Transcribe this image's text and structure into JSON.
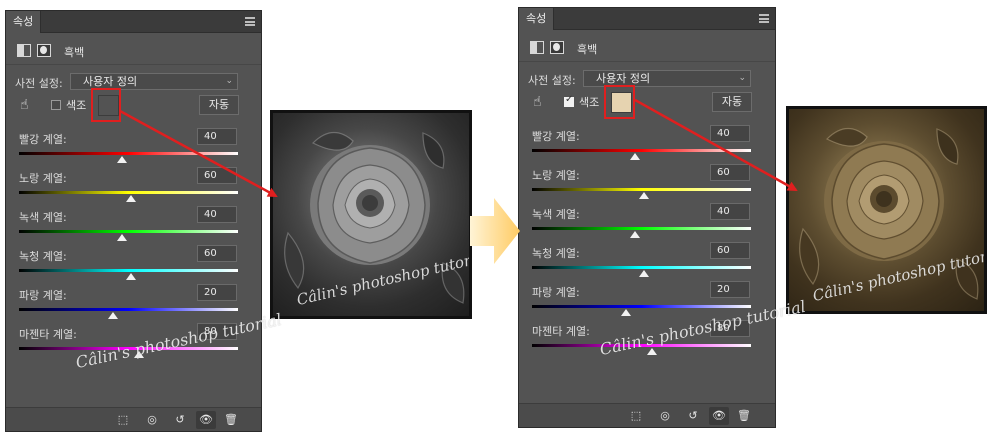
{
  "panels": [
    {
      "tab": "속성",
      "layer_name": "흑백",
      "preset_label": "사전 설정:",
      "preset_value": "사용자 정의",
      "tint_label": "색조",
      "tint_checked": false,
      "tint_color": "#535353",
      "auto_label": "자동",
      "sliders": [
        {
          "label": "빨강 계열:",
          "value": "40",
          "fraction": 0.47
        },
        {
          "label": "노랑 계열:",
          "value": "60",
          "fraction": 0.51
        },
        {
          "label": "녹색 계열:",
          "value": "40",
          "fraction": 0.47
        },
        {
          "label": "녹청 계열:",
          "value": "60",
          "fraction": 0.51
        },
        {
          "label": "파랑 계열:",
          "value": "20",
          "fraction": 0.43
        },
        {
          "label": "마젠타 계열:",
          "value": "80",
          "fraction": 0.55
        }
      ]
    },
    {
      "tab": "속성",
      "layer_name": "흑백",
      "preset_label": "사전 설정:",
      "preset_value": "사용자 정의",
      "tint_label": "색조",
      "tint_checked": true,
      "tint_color": "#e6d3b0",
      "auto_label": "자동",
      "sliders": [
        {
          "label": "빨강 계열:",
          "value": "40",
          "fraction": 0.47
        },
        {
          "label": "노랑 계열:",
          "value": "60",
          "fraction": 0.51
        },
        {
          "label": "녹색 계열:",
          "value": "40",
          "fraction": 0.47
        },
        {
          "label": "녹청 계열:",
          "value": "60",
          "fraction": 0.51
        },
        {
          "label": "파랑 계열:",
          "value": "20",
          "fraction": 0.43
        },
        {
          "label": "마젠타 계열:",
          "value": "80",
          "fraction": 0.55
        }
      ]
    }
  ],
  "slider_gradients": [
    [
      "#000000",
      "#ff0000",
      "#ffffff"
    ],
    [
      "#000000",
      "#ffff00",
      "#ffffff"
    ],
    [
      "#000000",
      "#00ff00",
      "#ffffff"
    ],
    [
      "#000000",
      "#00ffff",
      "#ffffff"
    ],
    [
      "#000000",
      "#0000ff",
      "#ffffff"
    ],
    [
      "#000000",
      "#ff00ff",
      "#ffffff"
    ]
  ],
  "bottom_icons": [
    "clip-to-layer-icon",
    "view-previous-state-icon",
    "reset-icon",
    "visibility-eye-icon",
    "delete-trash-icon"
  ],
  "watermark": "Câlin's photoshop tutorial",
  "accent_red": "#e01f1f",
  "arrow_color": "#ffd27a"
}
